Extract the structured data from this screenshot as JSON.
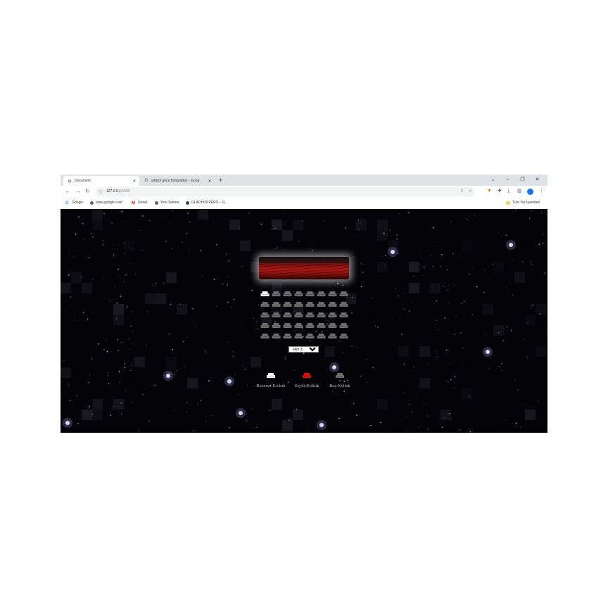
{
  "browser": {
    "tabs": [
      {
        "label": "Document",
        "active": true,
        "icon": "globe-icon"
      },
      {
        "label": "yıldızlı gece fotoğrafları - Goog",
        "active": false,
        "icon": "google-g-icon"
      }
    ],
    "new_tab_label": "+",
    "window_controls": {
      "tab_search": "⌄",
      "minimize": "–",
      "restore": "❐",
      "close": "✕"
    },
    "address": {
      "url_host": "127.0.0.1",
      "url_port": ":5500"
    },
    "bookmarks": [
      {
        "label": "Google",
        "icon": "google-g-icon"
      },
      {
        "label": "www.google.com",
        "icon": "globe-icon"
      },
      {
        "label": "Gmail",
        "icon": "gmail-icon"
      },
      {
        "label": "Yeni Sekme",
        "icon": "globe-icon"
      },
      {
        "label": "GLADHOPPERS – G...",
        "icon": "site-icon"
      }
    ],
    "all_bookmarks_label": "Tüm Yer İşaretleri"
  },
  "cinema": {
    "seat_rows": [
      [
        "reserved",
        "empty",
        "empty",
        "empty",
        "empty",
        "empty",
        "empty",
        "empty"
      ],
      [
        "empty",
        "empty",
        "empty",
        "empty",
        "empty",
        "empty",
        "empty",
        "empty"
      ],
      [
        "empty",
        "empty",
        "empty",
        "empty",
        "empty",
        "empty",
        "empty",
        "empty"
      ],
      [
        "empty",
        "empty",
        "empty",
        "empty",
        "empty",
        "empty",
        "empty",
        "empty"
      ],
      [
        "empty",
        "empty",
        "empty",
        "empty",
        "empty",
        "empty",
        "empty",
        "empty"
      ]
    ],
    "movie_select": {
      "selected": "Film 3",
      "options": [
        "Film 3"
      ]
    },
    "legend": [
      {
        "label": "Rezerve Koltuk",
        "state": "reserved"
      },
      {
        "label": "Seçili Koltuk",
        "state": "selected"
      },
      {
        "label": "Boş Koltuk",
        "state": "empty"
      }
    ],
    "colors": {
      "reserved": "#ffffff",
      "selected": "#e01010",
      "empty": "#6d6d6d",
      "background": "#030308"
    }
  }
}
